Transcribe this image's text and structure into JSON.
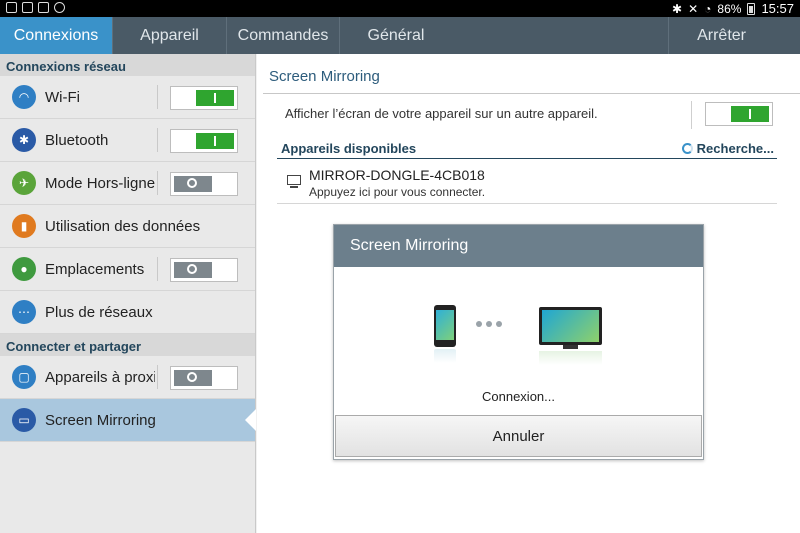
{
  "status_bar": {
    "battery": "86%",
    "time": "15:57"
  },
  "tabs": [
    {
      "label": "Connexions"
    },
    {
      "label": "Appareil"
    },
    {
      "label": "Commandes"
    },
    {
      "label": "Général"
    }
  ],
  "stop_label": "Arrêter",
  "sidebar": {
    "section1": "Connexions réseau",
    "section2": "Connecter et partager",
    "items": [
      {
        "label": "Wi-Fi",
        "icon": "wifi-icon",
        "toggle": "on"
      },
      {
        "label": "Bluetooth",
        "icon": "bluetooth-icon",
        "toggle": "on"
      },
      {
        "label": "Mode Hors-ligne",
        "icon": "airplane-icon",
        "toggle": "off"
      },
      {
        "label": "Utilisation des données",
        "icon": "data-usage-icon"
      },
      {
        "label": "Emplacements",
        "icon": "location-icon",
        "toggle": "off"
      },
      {
        "label": "Plus de réseaux",
        "icon": "more-networks-icon"
      },
      {
        "label": "Appareils à proxi",
        "icon": "nearby-devices-icon",
        "toggle": "off"
      },
      {
        "label": "Screen Mirroring",
        "icon": "screen-mirroring-icon",
        "selected": true
      }
    ]
  },
  "main": {
    "title": "Screen Mirroring",
    "share_text": "Afficher l’écran de votre appareil sur un autre appareil.",
    "share_toggle": "on",
    "available_header": "Appareils disponibles",
    "search_status": "Recherche...",
    "device": {
      "name": "MIRROR-DONGLE-4CB018",
      "hint": "Appuyez ici pour vous connecter."
    }
  },
  "dialog": {
    "title": "Screen Mirroring",
    "status": "Connexion...",
    "cancel_label": "Annuler"
  },
  "colors": {
    "tab_active": "#3a92c9",
    "tab_bar": "#4a5a66",
    "toggle_on": "#2fa52f",
    "sidebar_selected": "#a9c7de",
    "dialog_header": "#6c7f8c"
  }
}
